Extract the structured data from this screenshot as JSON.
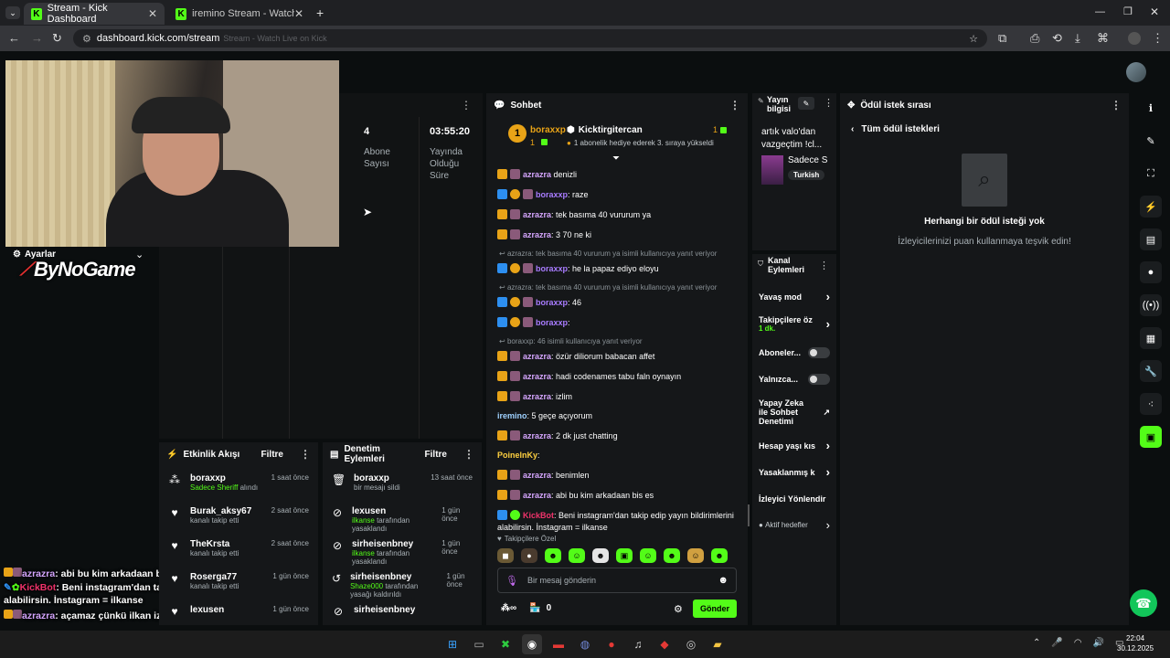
{
  "browser": {
    "tabs": [
      {
        "title": "Stream - Kick Dashboard"
      },
      {
        "title": "iremino Stream - Watch Live on"
      }
    ],
    "url": "dashboard.kick.com/stream",
    "ghost_text": "Stream - Watch Live on Kick"
  },
  "stats": {
    "subs_value": "4",
    "subs_label": "Abone Sayısı",
    "uptime_value": "03:55:20",
    "uptime_label": "Yayında Olduğu Süre"
  },
  "overlay": {
    "settings_label": "Ayarlar",
    "brand": "ByNoGame"
  },
  "activity": {
    "title": "Etkinlik Akışı",
    "filter": "Filtre",
    "items": [
      {
        "name": "boraxxp",
        "sub": "Sadece Sheriff",
        "sub2": " alındı",
        "time": "1 saat önce",
        "icon": "user-group-icon"
      },
      {
        "name": "Burak_aksy67",
        "sub": "",
        "sub2": "kanalı takip etti",
        "time": "2 saat önce",
        "icon": "heart-icon"
      },
      {
        "name": "TheKrsta",
        "sub": "",
        "sub2": "kanalı takip etti",
        "time": "2 saat önce",
        "icon": "heart-icon"
      },
      {
        "name": "Roserga77",
        "sub": "",
        "sub2": "kanalı takip etti",
        "time": "1 gün önce",
        "icon": "heart-icon"
      },
      {
        "name": "lexusen",
        "sub": "",
        "sub2": "",
        "time": "1 gün önce",
        "icon": "heart-icon"
      }
    ]
  },
  "moderation": {
    "title": "Denetim Eylemleri",
    "filter": "Filtre",
    "items": [
      {
        "name": "boraxxp",
        "sub": "",
        "sub2": "bir mesajı sildi",
        "time": "13 saat önce",
        "icon": "trash-icon"
      },
      {
        "name": "lexusen",
        "sub": "ilkanse",
        "sub2": " tarafından yasaklandı",
        "time": "1 gün önce",
        "icon": "ban-icon"
      },
      {
        "name": "sirheisenbney",
        "sub": "ilkanse",
        "sub2": " tarafından yasaklandı",
        "time": "1 gün önce",
        "icon": "ban-icon"
      },
      {
        "name": "sirheisenbney",
        "sub": "Shaze000",
        "sub2": " tarafından yasağı kaldırıldı",
        "time": "1 gün önce",
        "icon": "unban-icon"
      },
      {
        "name": "sirheisenbney",
        "sub": "",
        "sub2": "",
        "time": "",
        "icon": "ban-icon"
      }
    ]
  },
  "chat": {
    "title": "Sohbet",
    "pinned_user": "boraxxp",
    "pinned_count": "1",
    "pinned_gifter": "Kicktirgitercan",
    "pinned_gift_count": "1",
    "pinned_msg": "1 abonelik hediye ederek 3. sıraya yükseldi",
    "messages": [
      {
        "type": "msg",
        "user": "azrazra",
        "cls": "un-a",
        "badges": [
          "b-crown",
          "b-sub"
        ],
        "text": " denizli"
      },
      {
        "type": "msg",
        "user": "boraxxp",
        "cls": "un-b",
        "badges": [
          "b-mod",
          "b-one",
          "b-sub"
        ],
        "text": ": raze"
      },
      {
        "type": "msg",
        "user": "azrazra",
        "cls": "un-a",
        "badges": [
          "b-crown",
          "b-sub"
        ],
        "text": ": tek basıma 40 vururum ya"
      },
      {
        "type": "msg",
        "user": "azrazra",
        "cls": "un-a",
        "badges": [
          "b-crown",
          "b-sub"
        ],
        "text": ": 3 70 ne ki"
      },
      {
        "type": "reply",
        "text": "azrazra: tek basıma 40 vururum ya isimli kullanıcıya yanıt veriyor"
      },
      {
        "type": "msg",
        "user": "boraxxp",
        "cls": "un-b",
        "badges": [
          "b-mod",
          "b-one",
          "b-sub"
        ],
        "text": ": he la papaz ediyo eloyu"
      },
      {
        "type": "reply",
        "text": "azrazra: tek basıma 40 vururum ya isimli kullanıcıya yanıt veriyor"
      },
      {
        "type": "msg",
        "user": "boraxxp",
        "cls": "un-b",
        "badges": [
          "b-mod",
          "b-one",
          "b-sub"
        ],
        "text": ": 46"
      },
      {
        "type": "msg",
        "user": "boraxxp",
        "cls": "un-b",
        "badges": [
          "b-mod",
          "b-one",
          "b-sub"
        ],
        "text": ": "
      },
      {
        "type": "reply",
        "text": "boraxxp: 46 isimli kullanıcıya yanıt veriyor"
      },
      {
        "type": "msg",
        "user": "azrazra",
        "cls": "un-a",
        "badges": [
          "b-crown",
          "b-sub"
        ],
        "text": ": özür diliorum babacan affet"
      },
      {
        "type": "msg",
        "user": "azrazra",
        "cls": "un-a",
        "badges": [
          "b-crown",
          "b-sub"
        ],
        "text": ": hadi codenames tabu faln oynayın"
      },
      {
        "type": "msg",
        "user": "azrazra",
        "cls": "un-a",
        "badges": [
          "b-crown",
          "b-sub"
        ],
        "text": ": izlim"
      },
      {
        "type": "msg",
        "user": "iremino",
        "cls": "un-i",
        "badges": [],
        "text": ": 5 geçe açıyorum"
      },
      {
        "type": "msg",
        "user": "azrazra",
        "cls": "un-a",
        "badges": [
          "b-crown",
          "b-sub"
        ],
        "text": ": 2 dk just chatting"
      },
      {
        "type": "msg",
        "user": "PoinelnKy",
        "cls": "un-p",
        "badges": [],
        "text": ": "
      },
      {
        "type": "msg",
        "user": "azrazra",
        "cls": "un-a",
        "badges": [
          "b-crown",
          "b-sub"
        ],
        "text": ": benimlen"
      },
      {
        "type": "msg",
        "user": "azrazra",
        "cls": "un-a",
        "badges": [
          "b-crown",
          "b-sub"
        ],
        "text": ": abi bu kim arkadaan bis es"
      },
      {
        "type": "msg2",
        "user": "KickBot",
        "cls": "un-k",
        "badges": [
          "b-mod",
          "b-green"
        ],
        "text": ": Beni instagram'dan takip edip yayın bildirimlerini alabilirsin. İnstagram = ilkanse"
      },
      {
        "type": "msg",
        "user": "azrazra",
        "cls": "un-a",
        "badges": [
          "b-crown",
          "b-sub"
        ],
        "text": ": açamaz çünkü ilkan izin vermiyo"
      }
    ],
    "emote_label": "Takipçilere Özel",
    "input_placeholder": "Bir mesaj gönderin",
    "points": "0",
    "send_label": "Gönder"
  },
  "stream_info": {
    "title": "Yayın bilgisi",
    "stream_title": "artık valo'dan vazgeçtim !cl...",
    "category": "Sadece S",
    "language": "Turkish"
  },
  "channel_actions": {
    "title": "Kanal Eylemleri",
    "slow_mode": "Yavaş mod",
    "followers_only": "Takipçilere öz",
    "followers_only_sub": "1 dk.",
    "subs_only": "Aboneler...",
    "emotes_only": "Yalnızca...",
    "ai_moderation": "Yapay Zeka ile Sohbet Denetimi",
    "account_age": "Hesap yaşı kıs",
    "banned_words": "Yasaklanmış k",
    "viewer_redirect": "İzleyici Yönlendir",
    "active_goals": "Aktif hedefler"
  },
  "rewards": {
    "title": "Ödül istek sırası",
    "back_label": "Tüm ödül istekleri",
    "empty_title": "Herhangi bir ödül isteği yok",
    "empty_sub": "İzleyicilerinizi puan kullanmaya teşvik edin!"
  },
  "overlay_chat": [
    {
      "user": "azrazra",
      "text": ": abi bu kim arkadaan bis es"
    },
    {
      "user": "KickBot",
      "text": ": Beni instagram'dan takip edip yayın bildirimlerini alabilirsin. İnstagram = ilkanse"
    },
    {
      "user": "azrazra",
      "text": ": açamaz çünkü ilkan izin vermiyo"
    }
  ],
  "taskbar": {
    "time": "22:04",
    "date": "30.12.2025"
  },
  "colors": {
    "accent": "#53fc18",
    "panel": "#151719",
    "background": "#0b0e0f"
  }
}
